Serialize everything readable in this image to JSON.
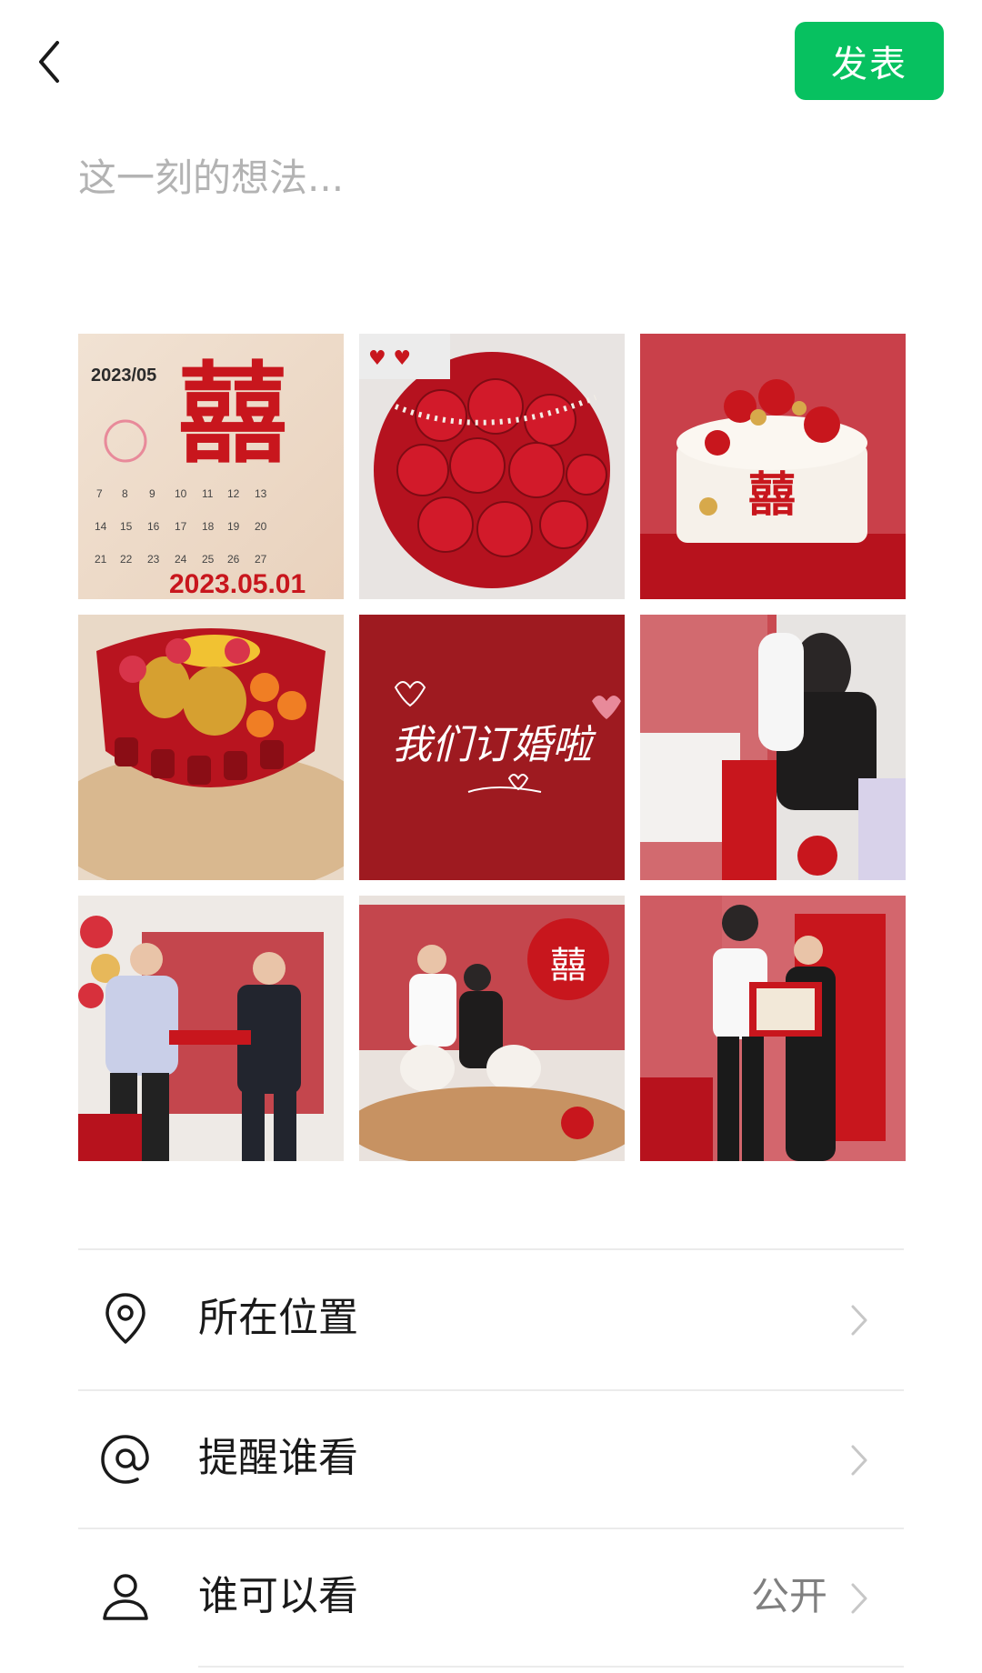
{
  "header": {
    "back_icon": "chevron-left-icon",
    "publish_label": "发表",
    "accent_color": "#07c160"
  },
  "composer": {
    "placeholder": "这一刻的想法..."
  },
  "photos": [
    {
      "name": "calendar-xi",
      "texts": [
        "2023/05",
        "2023.05.01"
      ]
    },
    {
      "name": "red-roses"
    },
    {
      "name": "wedding-cake"
    },
    {
      "name": "fruit-platter"
    },
    {
      "name": "engagement-card",
      "texts": [
        "我们订婚啦"
      ]
    },
    {
      "name": "signing-ceremony"
    },
    {
      "name": "handshake-exchange"
    },
    {
      "name": "couple-seated"
    },
    {
      "name": "couple-certificate"
    }
  ],
  "menu": {
    "location": {
      "label": "所在位置",
      "icon": "location-pin-icon"
    },
    "mention": {
      "label": "提醒谁看",
      "icon": "at-sign-icon"
    },
    "visibility": {
      "label": "谁可以看",
      "value": "公开",
      "icon": "person-icon"
    }
  }
}
